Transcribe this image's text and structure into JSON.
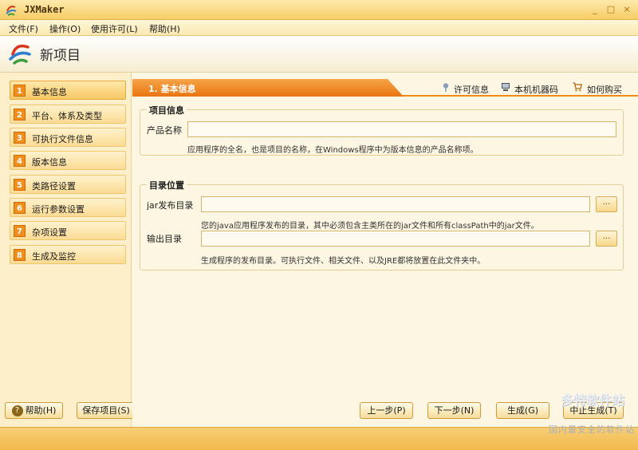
{
  "window": {
    "title": "JXMaker",
    "controls": [
      "_",
      "□",
      "×"
    ]
  },
  "menu": [
    {
      "label": "文件(F)"
    },
    {
      "label": "操作(O)"
    },
    {
      "label": "使用许可(L)"
    },
    {
      "label": "帮助(H)"
    }
  ],
  "header": {
    "title": "新项目"
  },
  "sidebar": {
    "items": [
      {
        "num": "1",
        "label": "基本信息",
        "active": true
      },
      {
        "num": "2",
        "label": "平台、体系及类型"
      },
      {
        "num": "3",
        "label": "可执行文件信息"
      },
      {
        "num": "4",
        "label": "版本信息"
      },
      {
        "num": "5",
        "label": "类路径设置"
      },
      {
        "num": "6",
        "label": "运行参数设置"
      },
      {
        "num": "7",
        "label": "杂项设置"
      },
      {
        "num": "8",
        "label": "生成及监控"
      }
    ]
  },
  "tab": {
    "label": "1. 基本信息",
    "links": [
      {
        "label": "许可信息",
        "icon": "pin-icon"
      },
      {
        "label": "本机机器码",
        "icon": "computer-icon"
      },
      {
        "label": "如何购买",
        "icon": "cart-icon"
      }
    ]
  },
  "project_info": {
    "title": "项目信息",
    "product_name_label": "产品名称",
    "product_name_value": "",
    "product_name_hint": "应用程序的全名，也是项目的名称，在Windows程序中为版本信息的产品名称项。"
  },
  "directory": {
    "title": "目录位置",
    "jar_label": "jar发布目录",
    "jar_value": "",
    "jar_hint": "您的java应用程序发布的目录，其中必须包含主类所在的jar文件和所有classPath中的jar文件。",
    "output_label": "输出目录",
    "output_value": "",
    "output_hint": "生成程序的发布目录。可执行文件、相关文件、以及JRE都将放置在此文件夹中。",
    "browse_label": "..."
  },
  "buttons": {
    "help": "帮助(H)",
    "save": "保存项目(S)",
    "prev": "上一步(P)",
    "next": "下一步(N)",
    "build": "生成(G)",
    "stop": "中止生成(T)"
  },
  "watermark": {
    "badge": "多特软件站",
    "line": "国内最安全的软件站"
  }
}
